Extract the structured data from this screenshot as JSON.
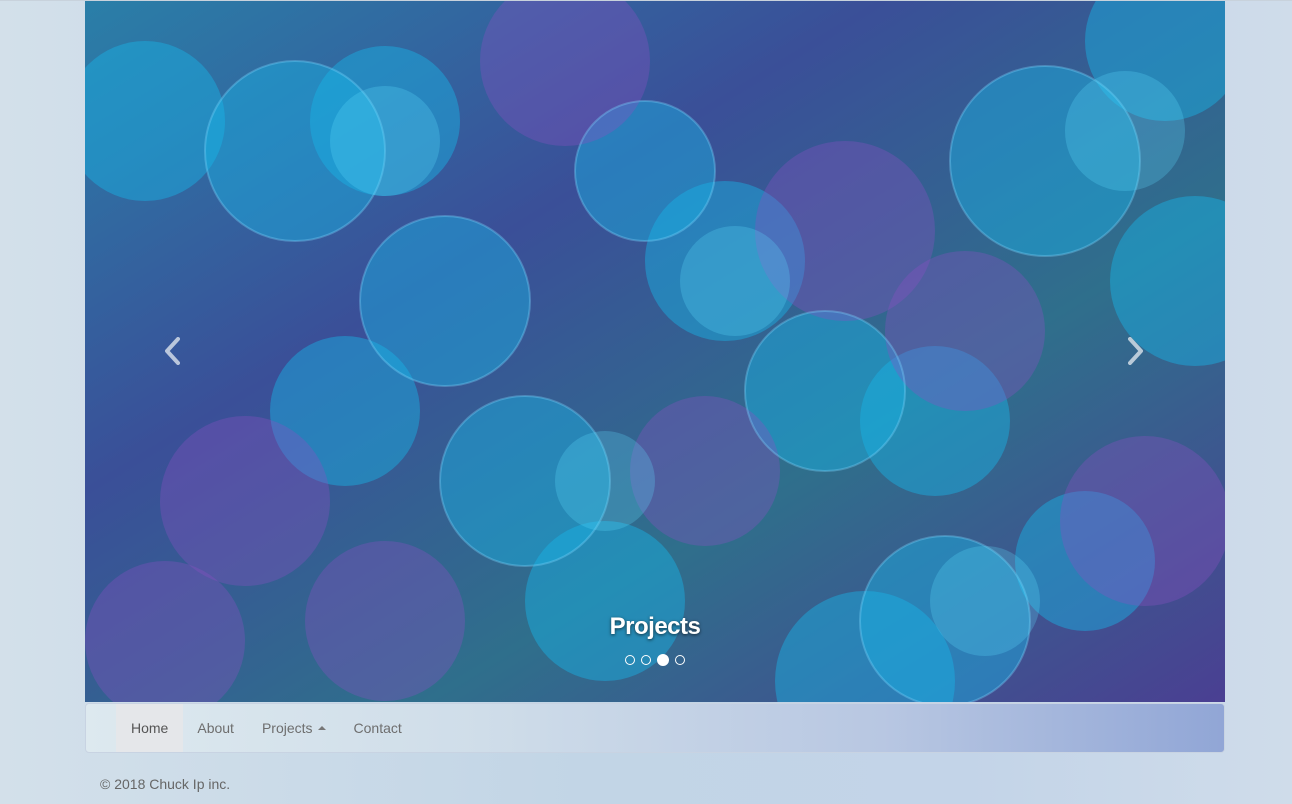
{
  "carousel": {
    "caption": "Projects",
    "prev_icon": "chevron-left-icon",
    "next_icon": "chevron-right-icon",
    "slide_count": 4,
    "active_slide": 3
  },
  "navbar": {
    "items": [
      {
        "label": "Home",
        "active": true
      },
      {
        "label": "About"
      },
      {
        "label": "Projects",
        "icon": "caret-up-icon"
      },
      {
        "label": "Contact"
      }
    ]
  },
  "footer": {
    "text": "© 2018 Chuck Ip inc."
  },
  "colors": {
    "background": "#c6d6e6",
    "navbar_accent": "#91a6d6",
    "caption_text": "#ffffff"
  }
}
